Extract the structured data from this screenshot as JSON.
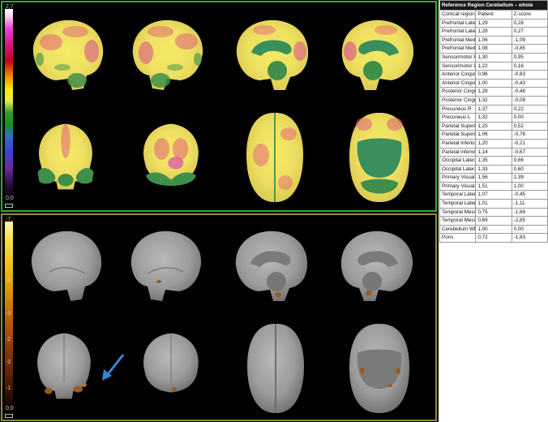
{
  "viewer": {
    "top_scale": {
      "max_label": "2,7",
      "min_label": "0,0"
    },
    "bottom_scale": {
      "max_label": "-7,",
      "min_label": "0,0",
      "tick_labels": [
        "-5",
        "-4",
        "-3",
        "-2",
        "-2",
        "-1"
      ]
    },
    "colors": {
      "top_border": "#39a83a",
      "bottom_border": "#8e8a3c",
      "arrow": "#3a83d4"
    },
    "views": [
      "lateral-right",
      "lateral-left",
      "medial-right",
      "medial-left",
      "anterior",
      "posterior",
      "superior",
      "inferior"
    ]
  },
  "table": {
    "title": "Reference Region Cerebellum – whole",
    "headers": [
      "Cortical region",
      "Patient",
      "Z-score"
    ],
    "rows": [
      [
        "Prefrontal Lateral R",
        "1,29",
        "0,28"
      ],
      [
        "Prefrontal Lateral L",
        "1,28",
        "0,27"
      ],
      [
        "Prefrontal Medial R",
        "1,06",
        "-1,09"
      ],
      [
        "Prefrontal Medial L",
        "1,08",
        "-0,85"
      ],
      [
        "Sensorimotor R",
        "1,30",
        "0,95"
      ],
      [
        "Sensorimotor L",
        "1,22",
        "0,16"
      ],
      [
        "Anterior Cingulate R",
        "0,96",
        "-0,83"
      ],
      [
        "Anterior Cingulate L",
        "1,00",
        "-0,43"
      ],
      [
        "Posterior Cingulate R",
        "1,28",
        "-0,48"
      ],
      [
        "Posterior Cingulate L",
        "1,32",
        "-0,09"
      ],
      [
        "Precuneus R",
        "1,37",
        "0,22"
      ],
      [
        "Precuneus L",
        "1,32",
        "0,00"
      ],
      [
        "Parietal Superior R",
        "1,25",
        "0,52"
      ],
      [
        "Parietal Superior L",
        "1,06",
        "-0,78"
      ],
      [
        "Parietal Inferior R",
        "1,20",
        "-0,21"
      ],
      [
        "Parietal inferior L",
        "1,14",
        "-0,67"
      ],
      [
        "Occipital Lateral R",
        "1,35",
        "0,66"
      ],
      [
        "Occipital Lateral L",
        "1,33",
        "0,60"
      ],
      [
        "Primary Visual R",
        "1,56",
        "1,39"
      ],
      [
        "Primary Visual L",
        "1,51",
        "1,00"
      ],
      [
        "Temporal Lateral R",
        "1,07",
        "-0,45"
      ],
      [
        "Temporal Lateral L",
        "1,01",
        "-1,11"
      ],
      [
        "Temporal Mesial R",
        "0,75",
        "-1,69"
      ],
      [
        "Temporal Mesial L",
        "0,69",
        "-2,85"
      ],
      [
        "Cerebellum Whole",
        "1,00",
        "0,00"
      ],
      [
        "Pons",
        "0,72",
        "-1,83"
      ]
    ]
  }
}
